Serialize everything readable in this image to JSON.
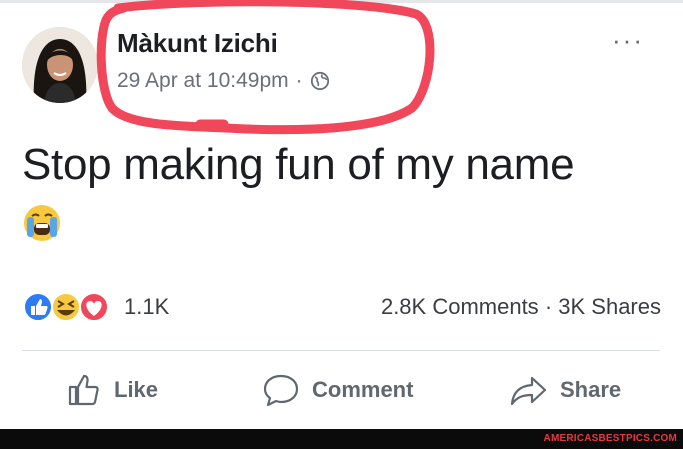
{
  "post": {
    "author": "Màkunt Izichi",
    "date": "29 Apr at 10:49pm",
    "separator": "·",
    "privacy_icon": "globe-icon",
    "more_label": "···",
    "text": "Stop making fun of my name",
    "emoji_icon": "loudly-crying-face-icon"
  },
  "reactions": {
    "icons": [
      "like-reaction-icon",
      "haha-reaction-icon",
      "love-reaction-icon"
    ],
    "count": "1.1K",
    "comments": "2.8K Comments",
    "stats_separator": "·",
    "shares": "3K Shares"
  },
  "actions": {
    "like": "Like",
    "comment": "Comment",
    "share": "Share"
  },
  "footer": {
    "watermark": "AMERICASBESTPICS.COM"
  },
  "colors": {
    "highlight": "#f0485a",
    "like_blue": "#2e7bf6",
    "haha_yellow": "#f7c940",
    "love_red": "#f0485a",
    "secondary_text": "#606770"
  }
}
